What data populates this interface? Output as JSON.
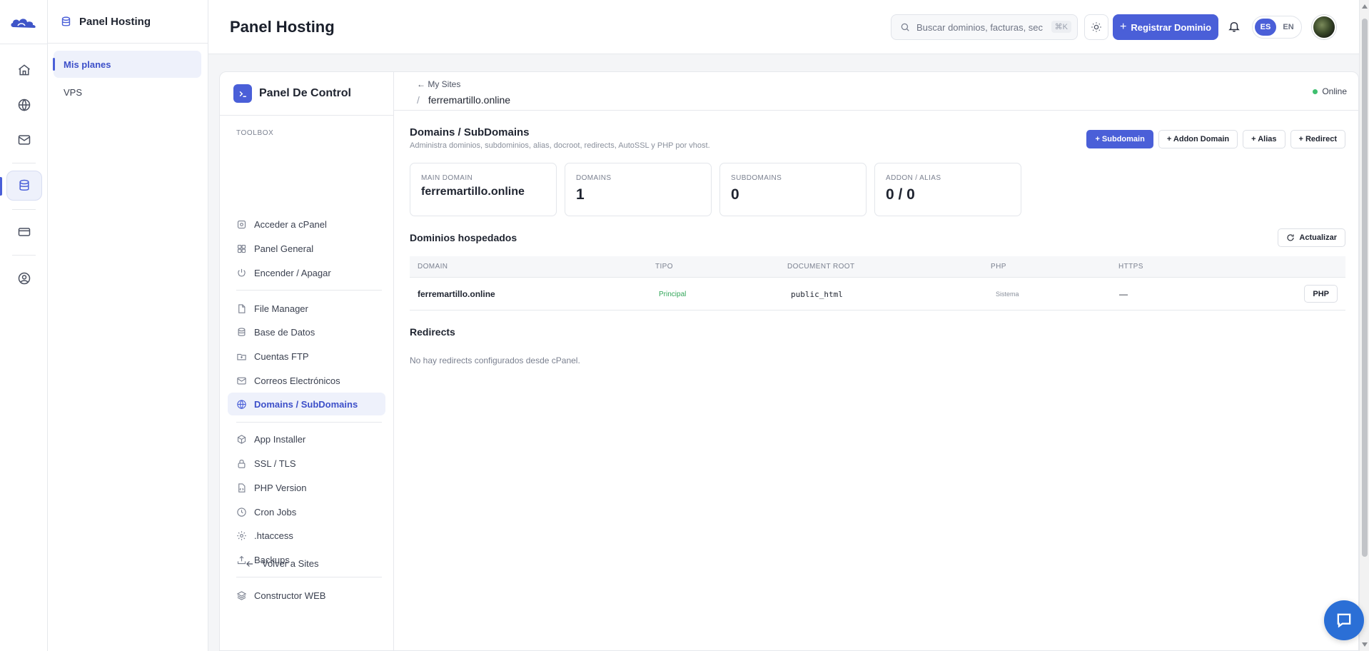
{
  "colors": {
    "accent": "#4a5fd8",
    "success": "#33a65a",
    "online": "#3fbf6f"
  },
  "rail": {
    "items": [
      {
        "icon": "home-icon"
      },
      {
        "icon": "globe-icon"
      },
      {
        "icon": "mail-icon"
      },
      {
        "icon": "database-icon",
        "active": true
      },
      {
        "icon": "credit-card-icon"
      },
      {
        "icon": "user-circle-icon"
      }
    ]
  },
  "sub": {
    "title": "Panel Hosting",
    "items": [
      {
        "label": "Mis planes",
        "active": true
      },
      {
        "label": "VPS"
      }
    ]
  },
  "topbar": {
    "title": "Panel Hosting",
    "search_placeholder": "Buscar dominios, facturas, sec",
    "search_shortcut": "⌘K",
    "register_label": "Registrar Dominio",
    "lang_es": "ES",
    "lang_en": "EN"
  },
  "cpanel": {
    "title": "Panel De Control",
    "toolbox_label": "TOOLBOX",
    "items": [
      {
        "label": "Acceder a cPanel",
        "icon": "cpanel-icon"
      },
      {
        "label": "Panel General",
        "icon": "grid-icon"
      },
      {
        "label": "Encender / Apagar",
        "icon": "power-icon"
      },
      {
        "label": "File Manager",
        "icon": "file-icon"
      },
      {
        "label": "Base de Datos",
        "icon": "database-icon"
      },
      {
        "label": "Cuentas FTP",
        "icon": "folder-upload-icon"
      },
      {
        "label": "Correos Electrónicos",
        "icon": "mail-icon"
      },
      {
        "label": "Domains / SubDomains",
        "icon": "globe-icon",
        "active": true
      },
      {
        "label": "App Installer",
        "icon": "box-icon"
      },
      {
        "label": "SSL / TLS",
        "icon": "lock-icon"
      },
      {
        "label": "PHP Version",
        "icon": "code-file-icon"
      },
      {
        "label": "Cron Jobs",
        "icon": "clock-icon"
      },
      {
        "label": ".htaccess",
        "icon": "gear-icon"
      },
      {
        "label": "Backups",
        "icon": "upload-icon"
      },
      {
        "label": "Constructor WEB",
        "icon": "layers-icon"
      }
    ],
    "back_label": "Volver a Sites"
  },
  "breadcrumb": {
    "back": "← My Sites",
    "slash": "/",
    "site": "ferremartillo.online",
    "status": "Online"
  },
  "section": {
    "title": "Domains / SubDomains",
    "description": "Administra dominios, subdominios, alias, docroot, redirects, AutoSSL y PHP por vhost.",
    "actions": [
      "+ Subdomain",
      "+ Addon Domain",
      "+ Alias",
      "+ Redirect"
    ]
  },
  "stats": [
    {
      "label": "MAIN DOMAIN",
      "value": "ferremartillo.online"
    },
    {
      "label": "DOMAINS",
      "value": "1"
    },
    {
      "label": "SUBDOMAINS",
      "value": "0"
    },
    {
      "label": "ADDON / ALIAS",
      "value": "0 / 0"
    }
  ],
  "hosted": {
    "title": "Dominios hospedados",
    "refresh_label": "Actualizar",
    "columns": [
      "DOMAIN",
      "TIPO",
      "DOCUMENT ROOT",
      "PHP",
      "HTTPS"
    ],
    "rows": [
      {
        "domain": "ferremartillo.online",
        "tipo": "Principal",
        "root": "public_html",
        "php": "Sistema",
        "https": "—",
        "action": "PHP"
      }
    ]
  },
  "redirects": {
    "title": "Redirects",
    "empty": "No hay redirects configurados desde cPanel."
  }
}
